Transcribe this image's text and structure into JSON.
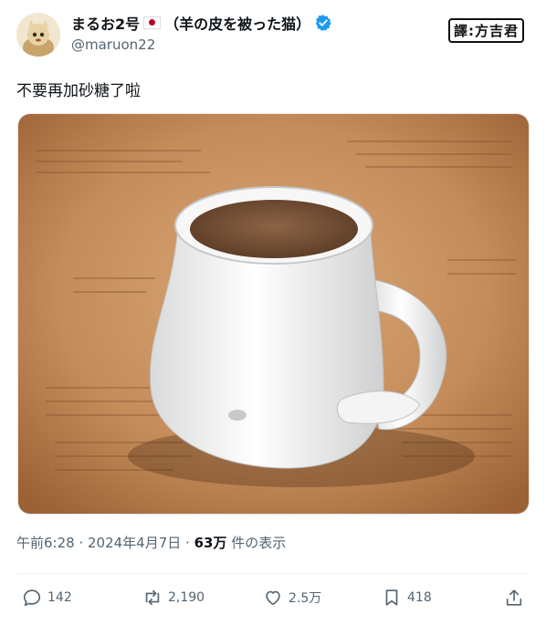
{
  "author": {
    "display_name": "まるお2号",
    "display_name_suffix": "（羊の皮を被った猫）",
    "handle": "@maruon22"
  },
  "watermark": "譯:方吉君",
  "tweet": {
    "text": "不要再加砂糖了啦"
  },
  "meta": {
    "timestamp": "午前6:28 · 2024年4月7日 · ",
    "views_count": "63万",
    "views_label": " 件の表示"
  },
  "actions": {
    "reply_count": "142",
    "retweet_count": "2,190",
    "like_count": "2.5万",
    "bookmark_count": "418"
  },
  "colors": {
    "verified": "#1d9bf0",
    "muted_text": "#536471",
    "primary_text": "#0f1419"
  },
  "icons": [
    "flag-japan-icon",
    "verified-badge-icon",
    "reply-icon",
    "retweet-icon",
    "like-icon",
    "bookmark-icon",
    "share-icon"
  ]
}
